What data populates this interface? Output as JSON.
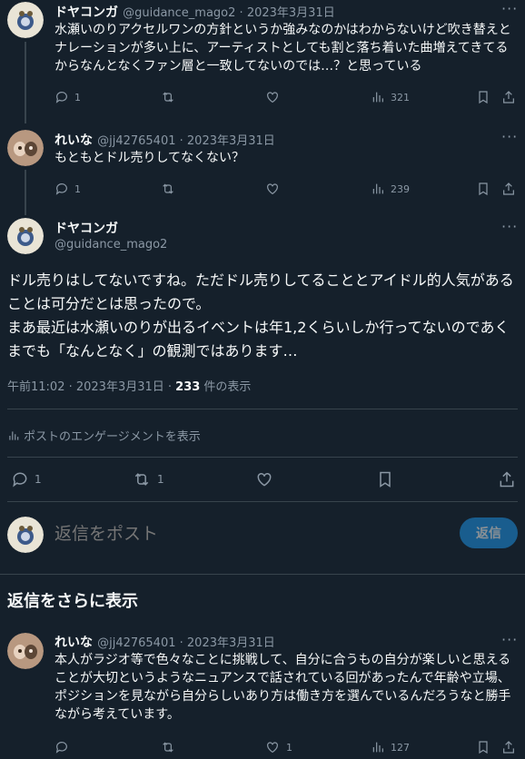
{
  "reply1": {
    "name": "ドヤコンガ",
    "handle": "@guidance_mago2",
    "date": "2023年3月31日",
    "text": "水瀬いのりアクセルワンの方針というか強みなのかはわからないけど吹き替えとナレーションが多い上に、アーティストとしても割と落ち着いた曲増えてきてるからなんとなくファン層と一致してないのでは…？と思っている",
    "stats": {
      "replies": "1",
      "reposts": "",
      "likes": "",
      "views": "321"
    }
  },
  "reply2": {
    "name": "れいな",
    "handle": "@jj42765401",
    "date": "2023年3月31日",
    "text": "もともとドル売りしてなくない？",
    "stats": {
      "replies": "1",
      "reposts": "",
      "likes": "",
      "views": "239"
    }
  },
  "main": {
    "name": "ドヤコンガ",
    "handle": "@guidance_mago2",
    "text_line1": "ドル売りはしてないですね。ただドル売りしてることとアイドル的人気があることは可分だとは思ったので。",
    "text_line2": "まあ最近は水瀬いのりが出るイベントは年1,2くらいしか行ってないのであくまでも「なんとなく」の観測ではあります…",
    "time": "午前11:02 · 2023年3月31日 · ",
    "views_count": "233",
    "views_suffix": " 件の表示",
    "engagement_label": "ポストのエンゲージメントを表示",
    "stats": {
      "replies": "1",
      "reposts": "1",
      "likes": ""
    }
  },
  "compose": {
    "placeholder": "返信をポスト",
    "button": "返信"
  },
  "more_replies_heading": "返信をさらに表示",
  "reply3": {
    "name": "れいな",
    "handle": "@jj42765401",
    "date": "2023年3月31日",
    "text": "本人がラジオ等で色々なことに挑戦して、自分に合うもの自分が楽しいと思えることが大切というようなニュアンスで話されている回があったんで年齢や立場、ポジションを見ながら自分らしいあり方は働き方を選んでいるんだろうなと勝手ながら考えています。",
    "stats": {
      "replies": "",
      "reposts": "",
      "likes": "1",
      "views": "127"
    }
  },
  "sep": " · ",
  "more_icon": "more-horizontal-icon",
  "colors": {
    "bg": "#15202b",
    "text": "#f7f9f9",
    "muted": "#8b98a5",
    "border": "#38444d",
    "accent": "#1d9bf0",
    "button": "#1d9bf0"
  }
}
